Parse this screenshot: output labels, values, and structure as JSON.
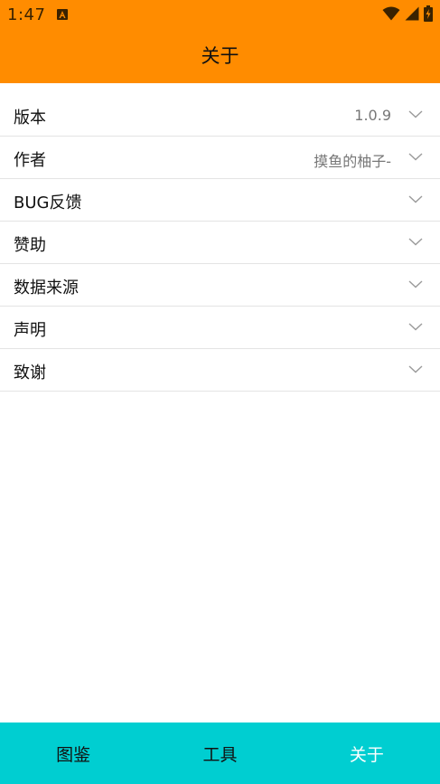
{
  "status_bar": {
    "time": "1:47",
    "icons": [
      "accessibility-app-icon",
      "wifi-icon",
      "cellular-signal-icon",
      "battery-charging-icon"
    ]
  },
  "header": {
    "title": "关于",
    "background_color": "#FF8C00"
  },
  "settings": {
    "items": [
      {
        "label": "版本",
        "value": "1.0.9"
      },
      {
        "label": "作者",
        "value": "摸鱼的柚子-"
      },
      {
        "label": "BUG反馈",
        "value": ""
      },
      {
        "label": "赞助",
        "value": ""
      },
      {
        "label": "数据来源",
        "value": ""
      },
      {
        "label": "声明",
        "value": ""
      },
      {
        "label": "致谢",
        "value": ""
      }
    ],
    "expand_icon": "chevron-down-icon"
  },
  "bottom_nav": {
    "background_color": "#00CED1",
    "items": [
      {
        "label": "图鉴"
      },
      {
        "label": "工具"
      },
      {
        "label": "关于"
      }
    ],
    "active": "关于"
  }
}
